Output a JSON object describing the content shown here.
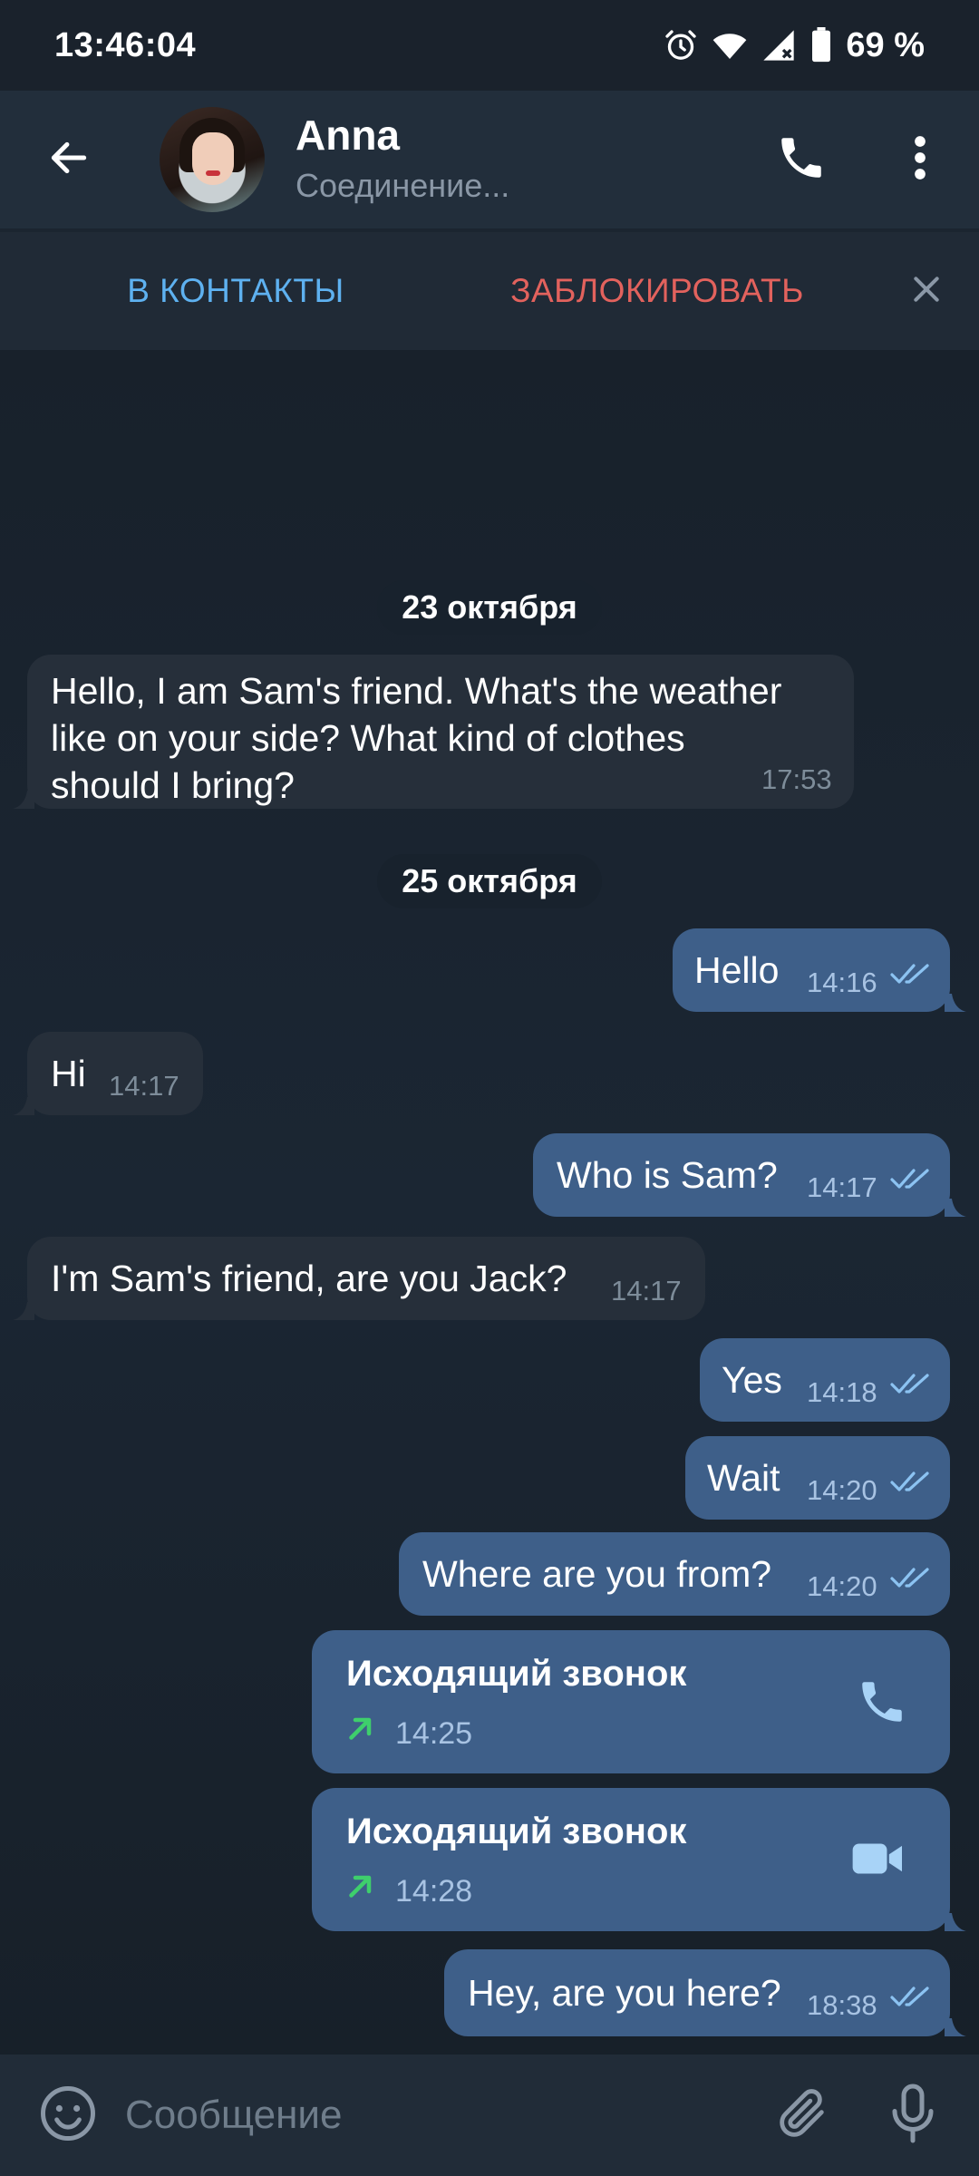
{
  "status_bar": {
    "time": "13:46:04",
    "battery_percent": "69 %",
    "icons": [
      "alarm-icon",
      "wifi-icon",
      "signal-icon",
      "battery-icon"
    ]
  },
  "header": {
    "name": "Anna",
    "status": "Соединение...",
    "icons": [
      "back-arrow-icon",
      "avatar",
      "phone-icon",
      "more-vertical-icon"
    ]
  },
  "action_bar": {
    "add_contact_label": "В КОНТАКТЫ",
    "block_label": "ЗАБЛОКИРОВАТЬ"
  },
  "messages": {
    "date1": "23 октября",
    "m1": {
      "text_line1": "Hello, I am Sam's friend. What's the weather",
      "text_line2": "like on your side? What kind of clothes",
      "text_line3": "should I bring?",
      "time": "17:53",
      "direction": "in"
    },
    "date2": "25 октября",
    "m2": {
      "text": "Hello",
      "time": "14:16",
      "direction": "out"
    },
    "m3": {
      "text": "Hi",
      "time": "14:17",
      "direction": "in"
    },
    "m4": {
      "text": "Who is Sam?",
      "time": "14:17",
      "direction": "out"
    },
    "m5": {
      "text": "I'm Sam's friend, are you Jack?",
      "time": "14:17",
      "direction": "in"
    },
    "m6": {
      "text": "Yes",
      "time": "14:18",
      "direction": "out"
    },
    "m7": {
      "text": "Wait",
      "time": "14:20",
      "direction": "out"
    },
    "m8": {
      "text": "Where are you from?",
      "time": "14:20",
      "direction": "out"
    },
    "call1": {
      "title": "Исходящий звонок",
      "time": "14:25",
      "kind": "voice"
    },
    "call2": {
      "title": "Исходящий звонок",
      "time": "14:28",
      "kind": "video"
    },
    "m9": {
      "text": "Hey, are you here?",
      "time": "18:38",
      "direction": "out"
    }
  },
  "input": {
    "placeholder": "Сообщение"
  },
  "colors": {
    "accent_blue": "#5eb1f0",
    "block_red": "#e2625d",
    "outgoing_bubble": "#3e5f89",
    "incoming_bubble": "#262f3a",
    "call_arrow_green": "#3ecf6c"
  }
}
